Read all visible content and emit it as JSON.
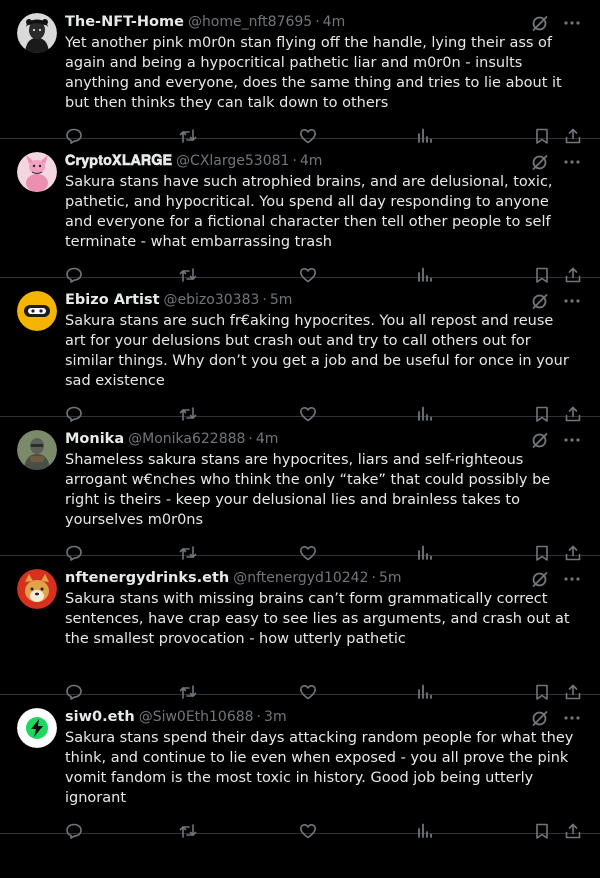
{
  "tweets": [
    {
      "name": "The-NFT-Home",
      "handle": "@home_nft87695",
      "time": "4m",
      "text": "Yet another pink m0r0n stan flying off the handle, lying their ass of again and being a hypocritical pathetic liar and m0r0n - insults anything and everyone, does the same thing and tries to lie about it but then thinks they can talk down to others",
      "avatar": "portrait-dark"
    },
    {
      "name": "𝐂𝐫𝐲𝐩𝐭𝐨𝐗𝐋𝐀𝐑𝐆𝐄",
      "handle": "@CXlarge53081",
      "time": "4m",
      "text": "Sakura stans have such atrophied brains, and are delusional, toxic, pathetic, and hypocritical. You spend all day responding to anyone and everyone for a fictional character then tell other people to self terminate - what embarrassing trash",
      "avatar": "pink-panther"
    },
    {
      "name": "Ebizo Artist",
      "handle": "@ebizo30383",
      "time": "5m",
      "text": "Sakura stans are such fr€aking hypocrites. You all repost and reuse art for your delusions but crash out and try to call others out for similar things. Why don’t you get a job and be useful for once in your sad existence",
      "avatar": "yellow-ninja"
    },
    {
      "name": "Monika",
      "handle": "@Monika622888",
      "time": "4m",
      "text": "Shameless sakura stans are hypocrites, liars and self-righteous arrogant w€nches who think the only “take” that could possibly be right is theirs - keep your delusional lies and brainless takes to yourselves m0r0ns",
      "avatar": "armored-figure"
    },
    {
      "name": "nftenergydrinks.eth",
      "handle": "@nftenergyd10242",
      "time": "5m",
      "text": "Sakura stans with missing brains can’t form grammatically correct sentences, have crap easy to see lies as arguments, and crash out at the smallest provocation - how utterly pathetic",
      "avatar": "shiba-red"
    },
    {
      "name": "siw0.eth",
      "handle": "@Siw0Eth10688",
      "time": "3m",
      "text": "Sakura stans spend their days attacking random people for what they think, and continue to lie even when exposed - you all prove the pink vomit fandom is the most toxic in history. Good job being utterly ignorant",
      "avatar": "green-bolt"
    }
  ],
  "icons": {
    "grok": "slashed-circle-icon",
    "more": "more-icon",
    "reply": "reply-icon",
    "repost": "repost-icon",
    "like": "like-icon",
    "views": "views-icon",
    "bookmark": "bookmark-icon",
    "share": "share-icon"
  },
  "colors": {
    "background": "#000000",
    "text": "#e7e9ea",
    "muted": "#71767b",
    "divider": "#2f3336"
  }
}
